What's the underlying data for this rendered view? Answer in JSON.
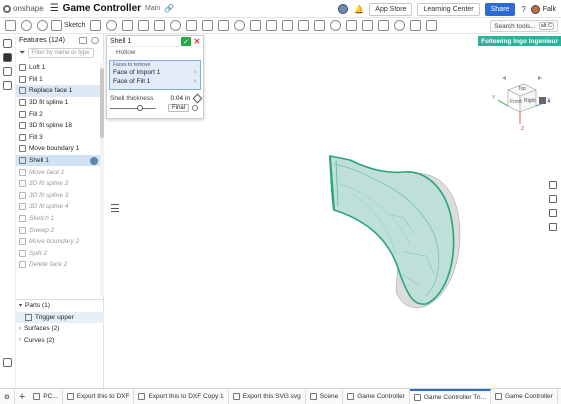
{
  "app": {
    "brand": "onshape",
    "document_title": "Game Controller",
    "branch": "Main"
  },
  "header": {
    "app_store_label": "App Store",
    "learning_center_label": "Learning Center",
    "share_label": "Share",
    "help_label": "?",
    "user_name": "Falk"
  },
  "toolbar": {
    "sketch_label": "Sketch",
    "search_label": "Search tools...",
    "search_shortcut": "alt C"
  },
  "features": {
    "header": "Features (124)",
    "filter_placeholder": "Filter by name or type",
    "items": [
      {
        "label": "Loft 1",
        "state": "normal"
      },
      {
        "label": "Fill 1",
        "state": "normal"
      },
      {
        "label": "Replace face 1",
        "state": "selected"
      },
      {
        "label": "3D fit spline 1",
        "state": "normal"
      },
      {
        "label": "Fill 2",
        "state": "normal"
      },
      {
        "label": "3D fit spline 18",
        "state": "normal"
      },
      {
        "label": "Fill 3",
        "state": "normal"
      },
      {
        "label": "Move boundary 1",
        "state": "normal"
      },
      {
        "label": "Shell 1",
        "state": "current"
      },
      {
        "label": "Move face 1",
        "state": "rolled"
      },
      {
        "label": "3D fit spline 2",
        "state": "rolled"
      },
      {
        "label": "3D fit spline 3",
        "state": "rolled"
      },
      {
        "label": "3D fit spline 4",
        "state": "rolled"
      },
      {
        "label": "Sketch 1",
        "state": "rolled"
      },
      {
        "label": "Sweep 2",
        "state": "rolled"
      },
      {
        "label": "Move boundary 2",
        "state": "rolled"
      },
      {
        "label": "Split 2",
        "state": "rolled"
      },
      {
        "label": "Delete face 2",
        "state": "rolled"
      }
    ],
    "parts_label": "Parts (1)",
    "part_item": "Trigger upper",
    "surfaces_label": "Surfaces (2)",
    "curves_label": "Curves (2)"
  },
  "shell_dialog": {
    "title": "Shell 1",
    "hollow_label": "Hollow",
    "faces_label": "Faces to remove",
    "faces": [
      "Face of Import 1",
      "Face of Fill 1"
    ],
    "thickness_label": "Shell thickness",
    "thickness_value": "0.04 in",
    "thickness_fraction": 0.65,
    "final_label": "Final"
  },
  "viewport": {
    "following_label": "Following Ingo Ingenieur",
    "view_cube": {
      "top": "Top",
      "front": "Front",
      "right": "Right"
    },
    "axes": {
      "x": "X",
      "y": "Y",
      "z": "Z"
    },
    "model_fill": "#bfe0d9",
    "model_edge": "#2aa37f",
    "model_outer": "#e6e6e6"
  },
  "tabs": {
    "items": [
      {
        "label": "PC...",
        "active": false
      },
      {
        "label": "Export this to DXF",
        "active": false
      },
      {
        "label": "Export this to DXF Copy 1",
        "active": false
      },
      {
        "label": "Export this SVG.svg",
        "active": false
      },
      {
        "label": "Scene",
        "active": false
      },
      {
        "label": "Game Controller",
        "active": false
      },
      {
        "label": "Game Controller Tri...",
        "active": true
      },
      {
        "label": "Game Controller",
        "active": false
      }
    ]
  },
  "colors": {
    "accent": "#2b6bd6",
    "selection": "#dce9f5",
    "following": "#25b59b",
    "ok": "#27a844"
  }
}
